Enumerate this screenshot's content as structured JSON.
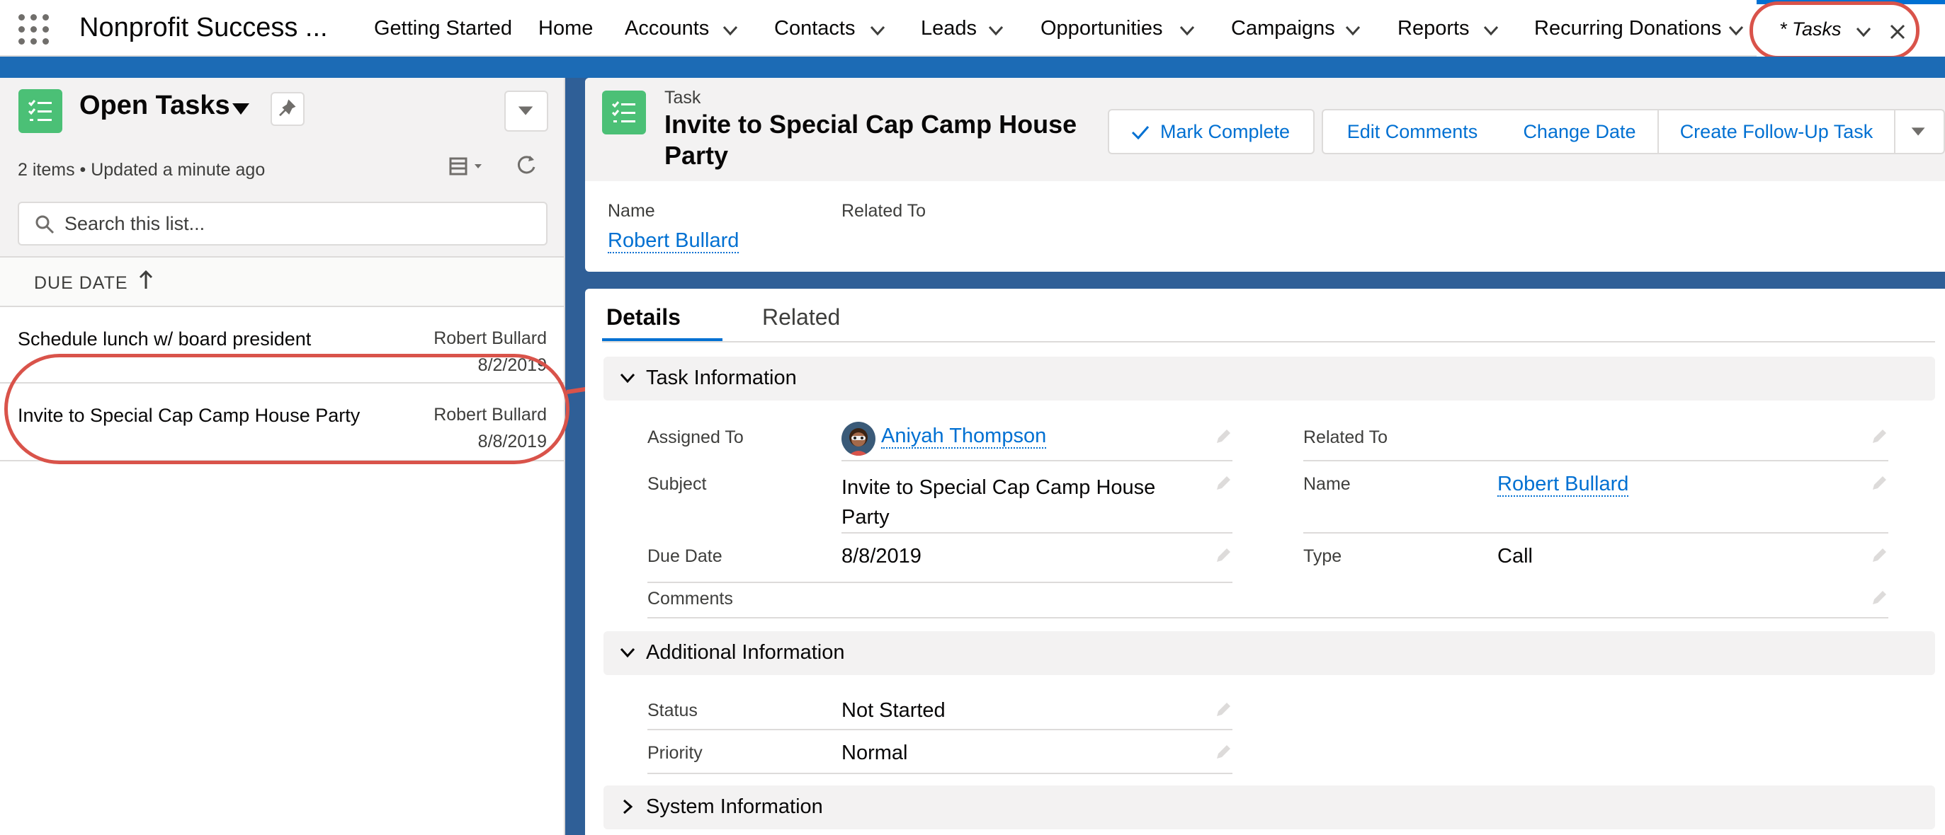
{
  "colors": {
    "brand": "#0070d2",
    "task_icon": "#4bc076",
    "annotation": "#d9534a",
    "banner": "#1c6bb5"
  },
  "app": {
    "launcher_icon": "app-launcher-grid-icon",
    "name": "Nonprofit Success ..."
  },
  "nav": {
    "items": [
      {
        "label": "Getting Started"
      },
      {
        "label": "Home"
      },
      {
        "label": "Accounts"
      },
      {
        "label": "Contacts"
      },
      {
        "label": "Leads"
      },
      {
        "label": "Opportunities"
      },
      {
        "label": "Campaigns"
      },
      {
        "label": "Reports"
      },
      {
        "label": "Recurring Donations"
      }
    ],
    "active_tab": {
      "label": "* Tasks",
      "close_icon": "close-icon",
      "chevron_icon": "chevron-down-icon"
    }
  },
  "list": {
    "title": "Open Tasks",
    "icon": "task-list-icon",
    "status": "2 items • Updated a minute ago",
    "search_placeholder": "Search this list...",
    "sort_column": "DUE DATE",
    "sort_direction": "ascending",
    "rows": [
      {
        "title": "Schedule lunch w/ board president",
        "related": "Robert Bullard",
        "date": "8/2/2019"
      },
      {
        "title": "Invite to Special Cap Camp House Party",
        "related": "Robert Bullard",
        "date": "8/8/2019"
      }
    ]
  },
  "record": {
    "object_label": "Task",
    "title_line1": "Invite to Special Cap Camp House",
    "title_line2": "Party",
    "actions": {
      "mark_complete": "Mark Complete",
      "edit_comments": "Edit Comments",
      "change_date": "Change Date",
      "follow_up": "Create Follow-Up Task"
    },
    "highlights": {
      "name_label": "Name",
      "name_value": "Robert Bullard",
      "related_label": "Related To"
    }
  },
  "tabs": {
    "details": "Details",
    "related": "Related",
    "selected": "Details"
  },
  "sections": {
    "task_info": {
      "title": "Task Information",
      "assigned_to_label": "Assigned To",
      "assigned_to_value": "Aniyah Thompson",
      "subject_label": "Subject",
      "subject_value_line1": "Invite to Special Cap Camp House",
      "subject_value_line2": "Party",
      "due_date_label": "Due Date",
      "due_date_value": "8/8/2019",
      "comments_label": "Comments",
      "related_to_label": "Related To",
      "name_label": "Name",
      "name_value": "Robert Bullard",
      "type_label": "Type",
      "type_value": "Call"
    },
    "additional_info": {
      "title": "Additional Information",
      "status_label": "Status",
      "status_value": "Not Started",
      "priority_label": "Priority",
      "priority_value": "Normal"
    },
    "system_info": {
      "title": "System Information"
    }
  }
}
